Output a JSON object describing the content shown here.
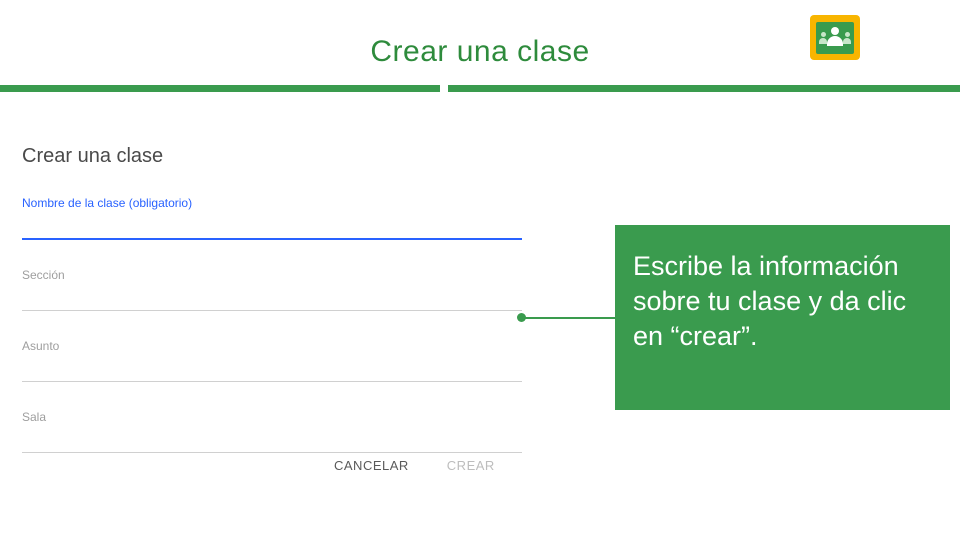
{
  "slide": {
    "title": "Crear una clase"
  },
  "form": {
    "title": "Crear una clase",
    "fields": {
      "class_name_label": "Nombre de la clase (obligatorio)",
      "section_label": "Sección",
      "subject_label": "Asunto",
      "room_label": "Sala"
    },
    "buttons": {
      "cancel": "CANCELAR",
      "create": "CREAR"
    }
  },
  "callout": {
    "text": "Escribe la información sobre tu clase y da clic en “crear”."
  },
  "logo": {
    "name": "google-classroom-icon"
  }
}
